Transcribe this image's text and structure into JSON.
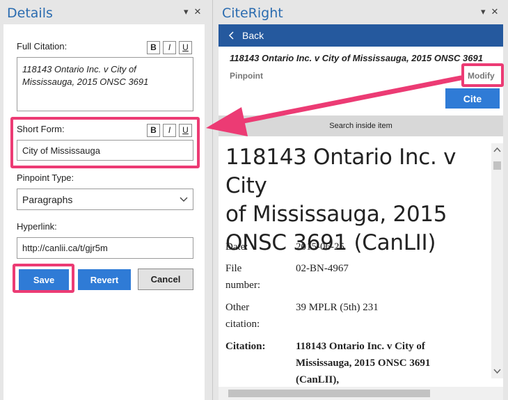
{
  "left": {
    "title": "Details",
    "ctrl": [
      "▾",
      "✕"
    ],
    "full_citation": {
      "label": "Full Citation:",
      "value_line1": "118143 Ontario Inc. v City of",
      "value_line2": "Mississauga, 2015 ONSC 3691"
    },
    "short_form": {
      "label": "Short Form:",
      "value": "City of Mississauga"
    },
    "format_buttons": [
      "B",
      "I",
      "U"
    ],
    "pinpoint_type": {
      "label": "Pinpoint Type:",
      "value": "Paragraphs"
    },
    "hyperlink": {
      "label": "Hyperlink:",
      "value": "http://canlii.ca/t/gjr5m"
    },
    "buttons": {
      "save": "Save",
      "revert": "Revert",
      "cancel": "Cancel"
    }
  },
  "right": {
    "title": "CiteRight",
    "ctrl": [
      "▾",
      "✕"
    ],
    "back": "Back",
    "item_title": "118143 Ontario Inc. v City of Mississauga, 2015 ONSC 3691",
    "pinpoint_label": "Pinpoint",
    "modify": "Modify",
    "cite": "Cite",
    "search": "Search inside item",
    "doc": {
      "title_l1": "118143 Ontario Inc. v City",
      "title_l2": "of Mississauga, 2015",
      "title_l3": "ONSC 3691 (CanLII)",
      "date_k": "Date:",
      "date_v": "2015-06-25",
      "file_k1": "File",
      "file_k2": "number:",
      "file_v": "02-BN-4967",
      "other_k1": "Other",
      "other_k2": "citation:",
      "other_v": "39 MPLR (5th) 231",
      "citation_k": "Citation:",
      "citation_v1": "118143 Ontario Inc. v City of",
      "citation_v2": "Mississauga, 2015 ONSC 3691",
      "citation_v3": "(CanLII),"
    }
  },
  "colors": {
    "highlight": "#ec3b74",
    "accent": "#2f7bd6",
    "header_blue": "#25599e"
  }
}
